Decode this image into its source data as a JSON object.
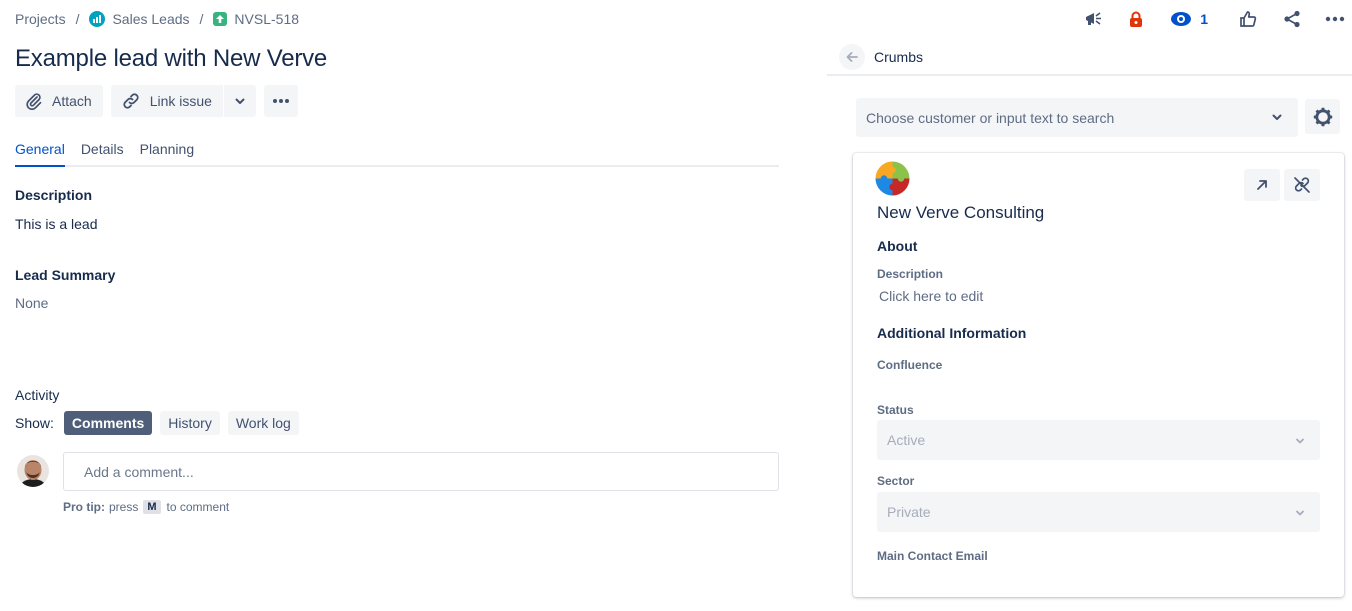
{
  "breadcrumb": {
    "projects": "Projects",
    "project": "Sales Leads",
    "issue_key": "NVSL-518",
    "separator": "/"
  },
  "top_actions": {
    "watch_count": "1",
    "icons": [
      "megaphone-icon",
      "lock-icon",
      "eye-icon",
      "thumbs-up-icon",
      "share-icon",
      "more-icon"
    ],
    "lock_color": "#de350b",
    "watch_color": "#0052cc"
  },
  "issue": {
    "title": "Example lead with New Verve"
  },
  "toolbar": {
    "attach_label": "Attach",
    "link_issue_label": "Link issue"
  },
  "tabs": [
    {
      "label": "General",
      "active": true
    },
    {
      "label": "Details",
      "active": false
    },
    {
      "label": "Planning",
      "active": false
    }
  ],
  "general": {
    "description_heading": "Description",
    "description_value": "This is a lead",
    "lead_summary_heading": "Lead Summary",
    "lead_summary_value": "None"
  },
  "activity": {
    "heading": "Activity",
    "show_label": "Show:",
    "filters": [
      {
        "label": "Comments",
        "active": true
      },
      {
        "label": "History",
        "active": false
      },
      {
        "label": "Work log",
        "active": false
      }
    ],
    "comment_placeholder": "Add a comment...",
    "protip_bold": "Pro tip:",
    "protip_press": "press",
    "protip_key": "M",
    "protip_rest": "to comment"
  },
  "panel": {
    "title": "Crumbs",
    "search_placeholder": "Choose customer or input text to search",
    "card": {
      "company_name": "New Verve Consulting",
      "about_heading": "About",
      "description_label": "Description",
      "description_value": "Click here to edit",
      "additional_heading": "Additional Information",
      "confluence_label": "Confluence",
      "status_label": "Status",
      "status_value": "Active",
      "sector_label": "Sector",
      "sector_value": "Private",
      "main_contact_label": "Main Contact Email"
    }
  },
  "colors": {
    "accent": "#0052cc",
    "text": "#172b4d",
    "subtle": "#5e6c84",
    "button_bg": "#f4f5f7",
    "active_pill": "#505f79",
    "project_icon": "#00a3bf",
    "story_icon": "#36b37e"
  }
}
